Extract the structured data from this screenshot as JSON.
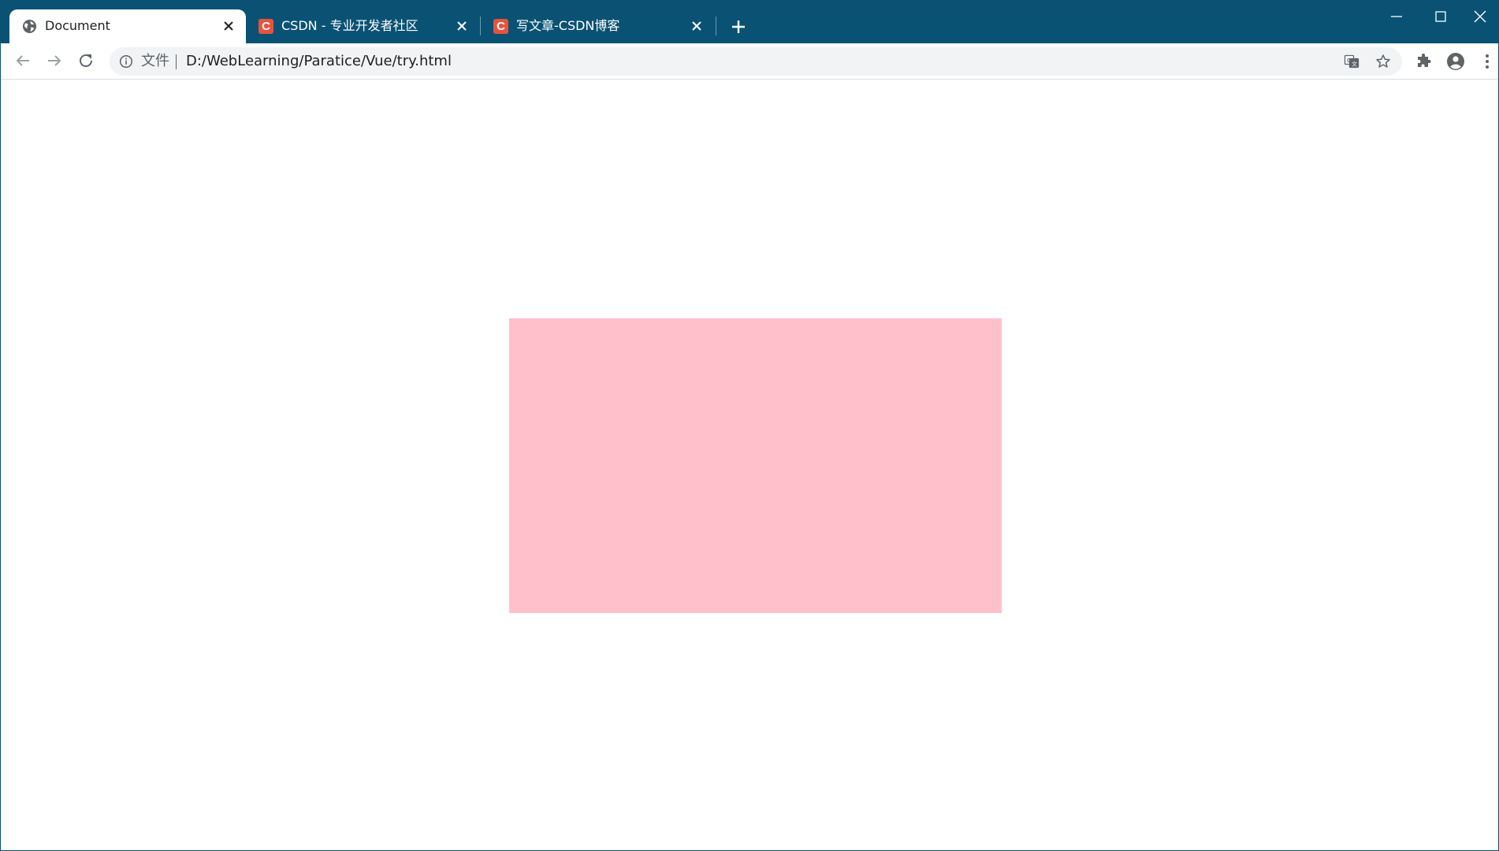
{
  "browser": {
    "tabs": [
      {
        "title": "Document",
        "icon": "globe-icon",
        "active": true
      },
      {
        "title": "CSDN - 专业开发者社区",
        "icon": "csdn-icon",
        "icon_letter": "C",
        "active": false
      },
      {
        "title": "写文章-CSDN博客",
        "icon": "csdn-icon",
        "icon_letter": "C",
        "active": false
      }
    ],
    "address_bar": {
      "origin_label": "文件",
      "url": "D:/WebLearning/Paratice/Vue/try.html"
    },
    "colors": {
      "frame": "#0a5274",
      "csdn_brand": "#e8533d"
    }
  },
  "page": {
    "box_color": "#ffc0cb"
  }
}
